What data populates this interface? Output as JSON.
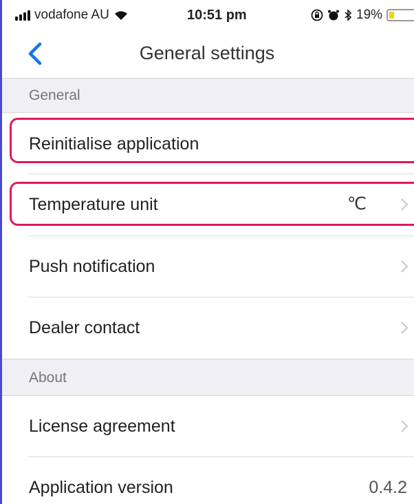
{
  "status_bar": {
    "carrier": "vodafone AU",
    "time": "10:51 pm",
    "battery": "19%",
    "battery_level": 0.19,
    "icons": [
      "signal-icon",
      "wifi-icon",
      "location-lock-icon",
      "alarm-icon",
      "bluetooth-icon",
      "battery-icon"
    ]
  },
  "nav": {
    "title": "General settings",
    "back_icon": "chevron-left-icon"
  },
  "sections": {
    "general": {
      "header": "General",
      "items": {
        "reinitialise": {
          "label": "Reinitialise application"
        },
        "temperature": {
          "label": "Temperature unit",
          "value": "℃"
        },
        "push": {
          "label": "Push notification"
        },
        "dealer": {
          "label": "Dealer contact"
        }
      }
    },
    "about": {
      "header": "About",
      "items": {
        "license": {
          "label": "License agreement"
        },
        "version": {
          "label": "Application version",
          "value": "0.4.2"
        }
      }
    }
  },
  "colors": {
    "accent": "#1a73e8",
    "highlight": "#e0175c",
    "section_bg": "#efeff4"
  }
}
